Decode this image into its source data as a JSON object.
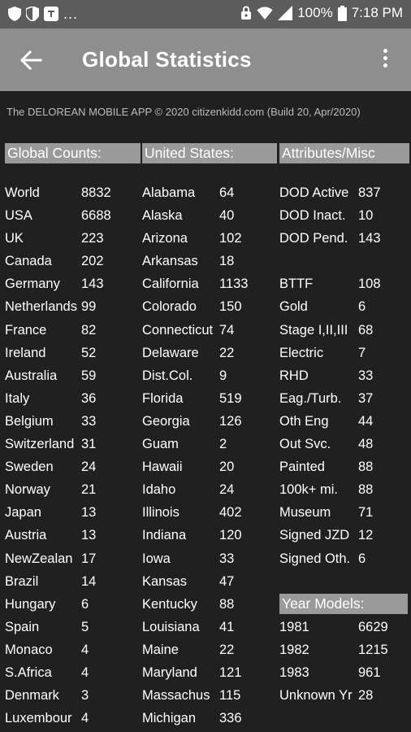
{
  "status": {
    "battery": "100%",
    "time": "7:18 PM",
    "left_dots": "..."
  },
  "header": {
    "title": "Global Statistics"
  },
  "copyright": "The DELOREAN MOBILE APP © 2020 citizenkidd.com (Build 20, Apr/2020)",
  "columns": {
    "global": {
      "header": "Global Counts:",
      "rows": [
        {
          "name": "World",
          "value": "8832"
        },
        {
          "name": "USA",
          "value": "6688"
        },
        {
          "name": "UK",
          "value": "223"
        },
        {
          "name": "Canada",
          "value": "202"
        },
        {
          "name": "Germany",
          "value": "143"
        },
        {
          "name": "Netherlands",
          "value": "99"
        },
        {
          "name": "France",
          "value": "82"
        },
        {
          "name": "Ireland",
          "value": "52"
        },
        {
          "name": "Australia",
          "value": "59"
        },
        {
          "name": "Italy",
          "value": "36"
        },
        {
          "name": "Belgium",
          "value": "33"
        },
        {
          "name": "Switzerland",
          "value": "31"
        },
        {
          "name": "Sweden",
          "value": "24"
        },
        {
          "name": "Norway",
          "value": "21"
        },
        {
          "name": "Japan",
          "value": "13"
        },
        {
          "name": "Austria",
          "value": "13"
        },
        {
          "name": "NewZealan",
          "value": "17"
        },
        {
          "name": "Brazil",
          "value": "14"
        },
        {
          "name": "Hungary",
          "value": "6"
        },
        {
          "name": "Spain",
          "value": "5"
        },
        {
          "name": "Monaco",
          "value": "4"
        },
        {
          "name": "S.Africa",
          "value": "4"
        },
        {
          "name": "Denmark",
          "value": "3"
        },
        {
          "name": "Luxembour",
          "value": "4"
        }
      ]
    },
    "us": {
      "header": "United States:",
      "rows": [
        {
          "name": "Alabama",
          "value": "64"
        },
        {
          "name": "Alaska",
          "value": "40"
        },
        {
          "name": "Arizona",
          "value": "102"
        },
        {
          "name": "Arkansas",
          "value": "18"
        },
        {
          "name": "California",
          "value": "1133"
        },
        {
          "name": "Colorado",
          "value": "150"
        },
        {
          "name": "Connecticut",
          "value": "74"
        },
        {
          "name": "Delaware",
          "value": "22"
        },
        {
          "name": "Dist.Col.",
          "value": "9"
        },
        {
          "name": "Florida",
          "value": "519"
        },
        {
          "name": "Georgia",
          "value": "126"
        },
        {
          "name": "Guam",
          "value": "2"
        },
        {
          "name": "Hawaii",
          "value": "20"
        },
        {
          "name": "Idaho",
          "value": "24"
        },
        {
          "name": "Illinois",
          "value": "402"
        },
        {
          "name": "Indiana",
          "value": "120"
        },
        {
          "name": "Iowa",
          "value": "33"
        },
        {
          "name": "Kansas",
          "value": "47"
        },
        {
          "name": "Kentucky",
          "value": "88"
        },
        {
          "name": "Louisiana",
          "value": "41"
        },
        {
          "name": "Maine",
          "value": "22"
        },
        {
          "name": "Maryland",
          "value": "121"
        },
        {
          "name": "Massachus",
          "value": "115"
        },
        {
          "name": "Michigan",
          "value": "336"
        }
      ]
    },
    "attributes": {
      "header": "Attributes/Misc",
      "rows": [
        {
          "name": "DOD Active",
          "value": "837"
        },
        {
          "name": "DOD Inact.",
          "value": "10"
        },
        {
          "name": "DOD Pend.",
          "value": "143"
        }
      ],
      "rows2": [
        {
          "name": "BTTF",
          "value": "108"
        },
        {
          "name": "Gold",
          "value": "6"
        },
        {
          "name": "Stage I,II,III",
          "value": "68"
        },
        {
          "name": "Electric",
          "value": "7"
        },
        {
          "name": "RHD",
          "value": "33"
        },
        {
          "name": "Eag./Turb.",
          "value": "37"
        },
        {
          "name": "Oth Eng",
          "value": "44"
        },
        {
          "name": "Out Svc.",
          "value": "48"
        },
        {
          "name": "Painted",
          "value": "88"
        },
        {
          "name": "100k+ mi.",
          "value": "88"
        },
        {
          "name": "Museum",
          "value": "71"
        },
        {
          "name": "Signed JZD",
          "value": "12"
        },
        {
          "name": "Signed Oth.",
          "value": "6"
        }
      ],
      "year_header": "Year Models:",
      "years": [
        {
          "name": "1981",
          "value": "6629"
        },
        {
          "name": "1982",
          "value": "1215"
        },
        {
          "name": "1983",
          "value": "961"
        },
        {
          "name": "Unknown Yr",
          "value": "28"
        }
      ]
    }
  }
}
